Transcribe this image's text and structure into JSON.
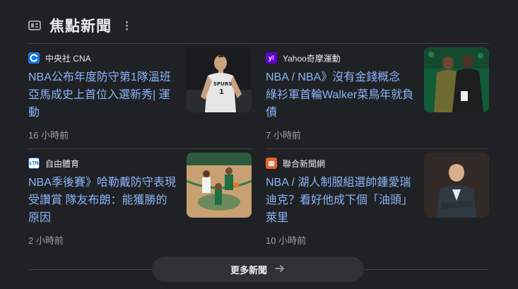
{
  "header": {
    "title": "焦點新聞",
    "icon": "newspaper-icon",
    "menu_icon": "more-vert-icon"
  },
  "articles": [
    {
      "source": "中央社 CNA",
      "source_logo_text": "C",
      "source_color": "#1a73e8",
      "headline": "NBA公布年度防守第1隊溫班亞馬成史上首位入選新秀| 運動",
      "time": "16 小時前",
      "thumbnail": "basketball-player-spurs-jersey"
    },
    {
      "source": "Yahoo奇摩運動",
      "source_logo_text": "y!",
      "source_color": "#6001d2",
      "headline": "NBA / NBA》沒有金錢概念 綠衫軍首輪Walker菜鳥年就負債",
      "time": "7 小時前",
      "thumbnail": "two-men-courtside"
    },
    {
      "source": "自由體育",
      "source_logo_text": "LTN",
      "source_color": "#1565c0",
      "headline": "NBA季後賽》哈勒戴防守表現受讚賞 隊友布朗：能獲勝的原因",
      "time": "2 小時前",
      "thumbnail": "basketball-game-action"
    },
    {
      "source": "聯合新聞網",
      "source_logo_text": "U",
      "source_color": "#e8622c",
      "headline": "NBA / 湖人制服組選帥鍾愛瑞迪克？看好他成下個「油頭」萊里",
      "time": "10 小時前",
      "thumbnail": "man-in-suit-portrait"
    }
  ],
  "footer": {
    "more_label": "更多新聞",
    "arrow_icon": "arrow-right-icon"
  }
}
